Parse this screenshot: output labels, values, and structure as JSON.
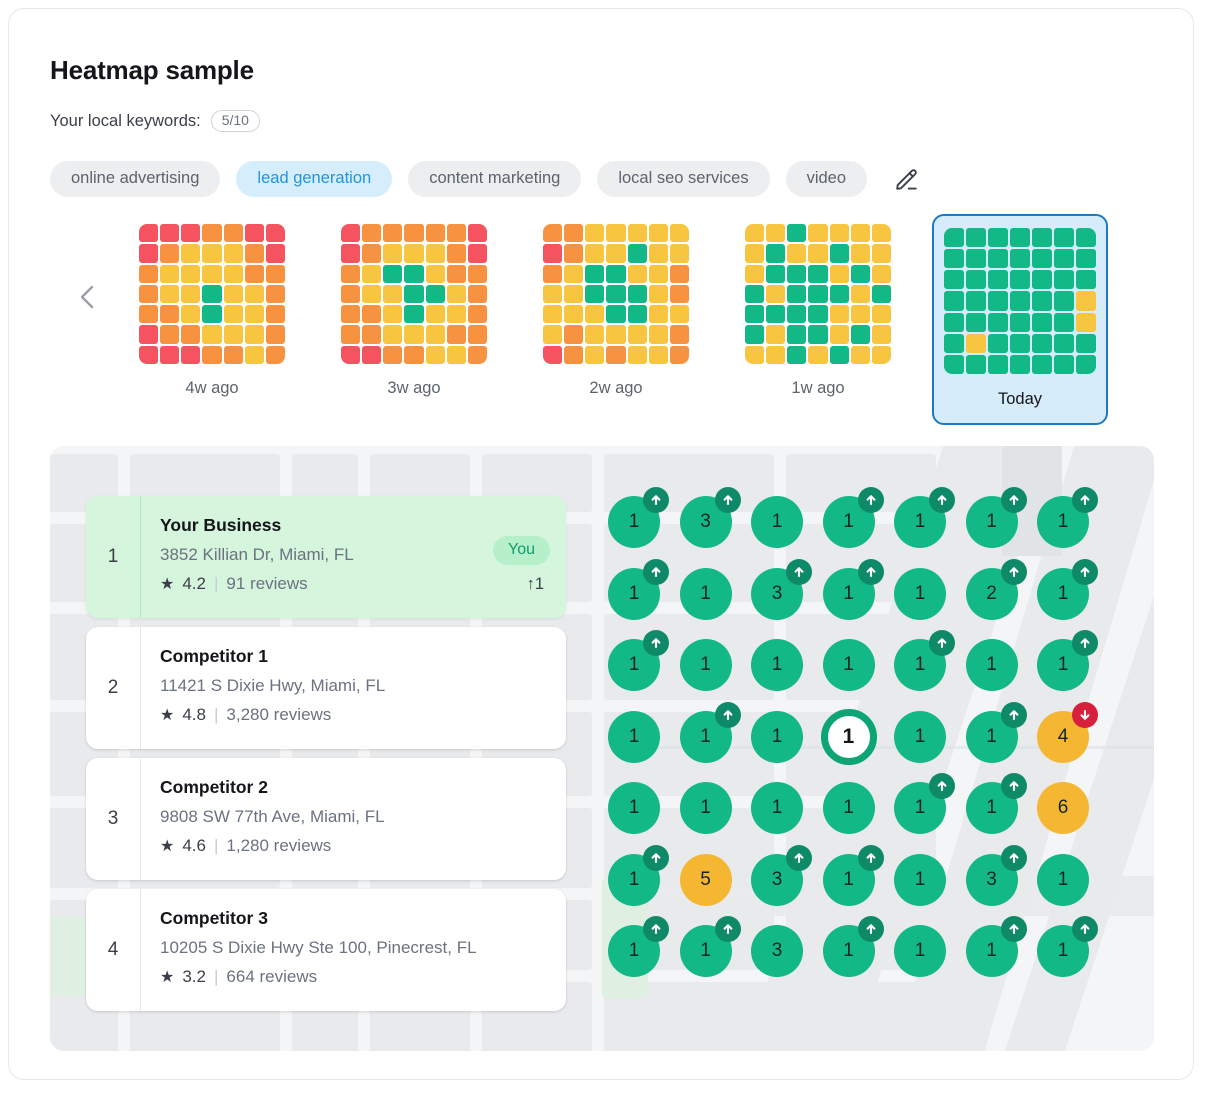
{
  "header": {
    "title": "Heatmap sample",
    "keywords_label": "Your local keywords:",
    "keywords_count": "5/10"
  },
  "keywords": {
    "chips": [
      {
        "label": "online advertising",
        "active": false
      },
      {
        "label": "lead generation",
        "active": true
      },
      {
        "label": "content marketing",
        "active": false
      },
      {
        "label": "local seo services",
        "active": false
      },
      {
        "label": "video",
        "active": false
      }
    ],
    "edit_icon": "pencil-icon"
  },
  "timeline": {
    "prev_icon": "chevron-left-icon",
    "snapshots": [
      {
        "label": "4w ago",
        "selected": false,
        "grid": [
          [
            "r",
            "r",
            "r",
            "o",
            "o",
            "r",
            "r"
          ],
          [
            "r",
            "o",
            "y",
            "y",
            "y",
            "o",
            "r"
          ],
          [
            "o",
            "y",
            "y",
            "y",
            "y",
            "o",
            "o"
          ],
          [
            "o",
            "y",
            "y",
            "g",
            "y",
            "y",
            "o"
          ],
          [
            "o",
            "o",
            "y",
            "g",
            "y",
            "y",
            "o"
          ],
          [
            "r",
            "o",
            "o",
            "y",
            "y",
            "y",
            "o"
          ],
          [
            "r",
            "r",
            "r",
            "o",
            "o",
            "y",
            "o"
          ]
        ]
      },
      {
        "label": "3w ago",
        "selected": false,
        "grid": [
          [
            "r",
            "o",
            "o",
            "o",
            "o",
            "o",
            "r"
          ],
          [
            "r",
            "o",
            "y",
            "y",
            "y",
            "o",
            "r"
          ],
          [
            "o",
            "y",
            "g",
            "g",
            "y",
            "o",
            "o"
          ],
          [
            "o",
            "y",
            "y",
            "g",
            "g",
            "y",
            "o"
          ],
          [
            "o",
            "o",
            "y",
            "g",
            "y",
            "y",
            "o"
          ],
          [
            "o",
            "o",
            "y",
            "y",
            "y",
            "o",
            "o"
          ],
          [
            "r",
            "r",
            "o",
            "o",
            "y",
            "y",
            "o"
          ]
        ]
      },
      {
        "label": "2w ago",
        "selected": false,
        "grid": [
          [
            "o",
            "o",
            "y",
            "y",
            "y",
            "y",
            "y"
          ],
          [
            "r",
            "o",
            "y",
            "y",
            "g",
            "y",
            "y"
          ],
          [
            "o",
            "y",
            "g",
            "g",
            "y",
            "y",
            "o"
          ],
          [
            "y",
            "y",
            "g",
            "g",
            "g",
            "y",
            "o"
          ],
          [
            "y",
            "y",
            "y",
            "g",
            "g",
            "y",
            "y"
          ],
          [
            "y",
            "o",
            "y",
            "y",
            "y",
            "y",
            "o"
          ],
          [
            "r",
            "o",
            "y",
            "o",
            "y",
            "y",
            "o"
          ]
        ]
      },
      {
        "label": "1w ago",
        "selected": false,
        "grid": [
          [
            "y",
            "y",
            "g",
            "y",
            "y",
            "y",
            "y"
          ],
          [
            "y",
            "g",
            "y",
            "y",
            "g",
            "y",
            "y"
          ],
          [
            "y",
            "g",
            "g",
            "g",
            "y",
            "g",
            "y"
          ],
          [
            "g",
            "y",
            "g",
            "g",
            "g",
            "y",
            "g"
          ],
          [
            "g",
            "g",
            "g",
            "g",
            "y",
            "y",
            "y"
          ],
          [
            "g",
            "y",
            "g",
            "g",
            "y",
            "g",
            "y"
          ],
          [
            "y",
            "y",
            "g",
            "y",
            "g",
            "y",
            "y"
          ]
        ]
      },
      {
        "label": "Today",
        "selected": true,
        "grid": [
          [
            "g",
            "g",
            "g",
            "g",
            "g",
            "g",
            "g"
          ],
          [
            "g",
            "g",
            "g",
            "g",
            "g",
            "g",
            "g"
          ],
          [
            "g",
            "g",
            "g",
            "g",
            "g",
            "g",
            "g"
          ],
          [
            "g",
            "g",
            "g",
            "g",
            "g",
            "g",
            "y"
          ],
          [
            "g",
            "g",
            "g",
            "g",
            "g",
            "g",
            "y"
          ],
          [
            "g",
            "y",
            "g",
            "g",
            "g",
            "g",
            "g"
          ],
          [
            "g",
            "g",
            "g",
            "g",
            "g",
            "g",
            "g"
          ]
        ]
      }
    ],
    "colors": {
      "g": "#12b886",
      "y": "#f7c53f",
      "o": "#f79340",
      "r": "#f4535f"
    }
  },
  "ranking": [
    {
      "rank": "1",
      "name": "Your Business",
      "address": "3852 Killian Dr, Miami, FL",
      "rating": "4.2",
      "reviews": "91 reviews",
      "badge": "You",
      "delta": "↑1",
      "is_you": true
    },
    {
      "rank": "2",
      "name": "Competitor 1",
      "address": "11421 S Dixie Hwy, Miami, FL",
      "rating": "4.8",
      "reviews": "3,280 reviews",
      "is_you": false
    },
    {
      "rank": "3",
      "name": "Competitor 2",
      "address": "9808 SW 77th Ave, Miami, FL",
      "rating": "4.6",
      "reviews": "1,280 reviews",
      "is_you": false
    },
    {
      "rank": "4",
      "name": "Competitor 3",
      "address": "10205 S Dixie Hwy Ste 100, Pinecrest, FL",
      "rating": "3.2",
      "reviews": "664 reviews",
      "is_you": false
    }
  ],
  "map": {
    "pin_colors": {
      "green": "#12b886",
      "yellow": "#f5b731",
      "badge_up": "#0e8a68",
      "badge_down": "#d6203c"
    },
    "pin_rows": [
      [
        {
          "value": "1",
          "color": "green",
          "trend": "up"
        },
        {
          "value": "3",
          "color": "green",
          "trend": "up"
        },
        {
          "value": "1",
          "color": "green",
          "trend": "none"
        },
        {
          "value": "1",
          "color": "green",
          "trend": "up"
        },
        {
          "value": "1",
          "color": "green",
          "trend": "up"
        },
        {
          "value": "1",
          "color": "green",
          "trend": "up"
        },
        {
          "value": "1",
          "color": "green",
          "trend": "up"
        }
      ],
      [
        {
          "value": "1",
          "color": "green",
          "trend": "up"
        },
        {
          "value": "1",
          "color": "green",
          "trend": "none"
        },
        {
          "value": "3",
          "color": "green",
          "trend": "up"
        },
        {
          "value": "1",
          "color": "green",
          "trend": "up"
        },
        {
          "value": "1",
          "color": "green",
          "trend": "none"
        },
        {
          "value": "2",
          "color": "green",
          "trend": "up"
        },
        {
          "value": "1",
          "color": "green",
          "trend": "up"
        }
      ],
      [
        {
          "value": "1",
          "color": "green",
          "trend": "up"
        },
        {
          "value": "1",
          "color": "green",
          "trend": "none"
        },
        {
          "value": "1",
          "color": "green",
          "trend": "none"
        },
        {
          "value": "1",
          "color": "green",
          "trend": "none"
        },
        {
          "value": "1",
          "color": "green",
          "trend": "up"
        },
        {
          "value": "1",
          "color": "green",
          "trend": "none"
        },
        {
          "value": "1",
          "color": "green",
          "trend": "up"
        }
      ],
      [
        {
          "value": "1",
          "color": "green",
          "trend": "none"
        },
        {
          "value": "1",
          "color": "green",
          "trend": "up"
        },
        {
          "value": "1",
          "color": "green",
          "trend": "none"
        },
        {
          "value": "1",
          "color": "center",
          "trend": "none"
        },
        {
          "value": "1",
          "color": "green",
          "trend": "none"
        },
        {
          "value": "1",
          "color": "green",
          "trend": "up"
        },
        {
          "value": "4",
          "color": "yellow",
          "trend": "down"
        }
      ],
      [
        {
          "value": "1",
          "color": "green",
          "trend": "none"
        },
        {
          "value": "1",
          "color": "green",
          "trend": "none"
        },
        {
          "value": "1",
          "color": "green",
          "trend": "none"
        },
        {
          "value": "1",
          "color": "green",
          "trend": "none"
        },
        {
          "value": "1",
          "color": "green",
          "trend": "up"
        },
        {
          "value": "1",
          "color": "green",
          "trend": "up"
        },
        {
          "value": "6",
          "color": "yellow",
          "trend": "none"
        }
      ],
      [
        {
          "value": "1",
          "color": "green",
          "trend": "up"
        },
        {
          "value": "5",
          "color": "yellow",
          "trend": "none"
        },
        {
          "value": "3",
          "color": "green",
          "trend": "up"
        },
        {
          "value": "1",
          "color": "green",
          "trend": "up"
        },
        {
          "value": "1",
          "color": "green",
          "trend": "none"
        },
        {
          "value": "3",
          "color": "green",
          "trend": "up"
        },
        {
          "value": "1",
          "color": "green",
          "trend": "none"
        }
      ],
      [
        {
          "value": "1",
          "color": "green",
          "trend": "up"
        },
        {
          "value": "1",
          "color": "green",
          "trend": "up"
        },
        {
          "value": "3",
          "color": "green",
          "trend": "none"
        },
        {
          "value": "1",
          "color": "green",
          "trend": "up"
        },
        {
          "value": "1",
          "color": "green",
          "trend": "none"
        },
        {
          "value": "1",
          "color": "green",
          "trend": "up"
        },
        {
          "value": "1",
          "color": "green",
          "trend": "up"
        }
      ]
    ]
  }
}
